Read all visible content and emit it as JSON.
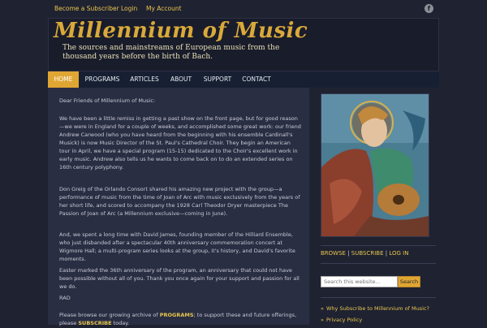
{
  "topbar": {
    "links": [
      "Become a Subscriber",
      "Login",
      "My Account"
    ],
    "facebook_icon": "facebook-icon"
  },
  "header": {
    "title": "Millennium of Music",
    "tagline": "The sources and mainstreams of European music from the thousand years before the birth of Bach."
  },
  "nav": {
    "items": [
      "HOME",
      "PROGRAMS",
      "ARTICLES",
      "ABOUT",
      "SUPPORT",
      "CONTACT"
    ],
    "active": "HOME"
  },
  "content": {
    "greeting": "Dear Friends of Millennium of Music:",
    "p1": "We have been a little remiss in getting a past show on the front page, but for good reason—we were in England for a couple of weeks, and accomplished some great work: our friend Andrew Carwood (who you have heard from the beginning with his ensemble Cardinall's Musick) is now Music Director of the St. Paul's Cathedral Choir. They begin an American tour in April, we have a special program (15-15) dedicated to the Choir's excellent work in early music. Andrew also tells us he wants to come back on to do an extended series on 16th century polyphony.",
    "p2": "Don Greig of the Orlando Consort shared his amazing new project with the group—a performance of music from the time of Joan of Arc with music exclusively from the years of her short life, and scored to accompany the 1928 Carl Theodor Dryer masterpiece The Passion of Joan of Arc (a Millennium exclusive—coming in June).",
    "p3": "And, we spent a long time with David James, founding member of the Hilliard Ensemble, who just disbanded after a spectacular 40th anniversary commemoration concert at Wigmore Hall; a multi-program series looks at the group, it's history, and David's favorite moments.",
    "p4": "Easter marked the 36th anniversary of the program, an anniversary that could not have been possible without all of you. Thank you once again for your support and passion for all we do.",
    "signature": "RAD",
    "p5_before": "Please browse our growing archive of ",
    "p5_programs": "PROGRAMS",
    "p5_after": "; to support these and future offerings,",
    "p6_before": "please ",
    "p6_subscribe": "SUBSCRIBE",
    "p6_after": " today."
  },
  "sidebar": {
    "links": [
      "BROWSE",
      "SUBSCRIBE",
      "LOG IN"
    ],
    "search_placeholder": "Search this website...",
    "search_button": "Search",
    "list": [
      "Why Subscribe to Millennium of Music?",
      "Privacy Policy"
    ]
  },
  "colors": {
    "accent": "#e0a633",
    "link": "#e8c64e",
    "background": "#1f2231",
    "content_bg": "#2a2e42"
  }
}
